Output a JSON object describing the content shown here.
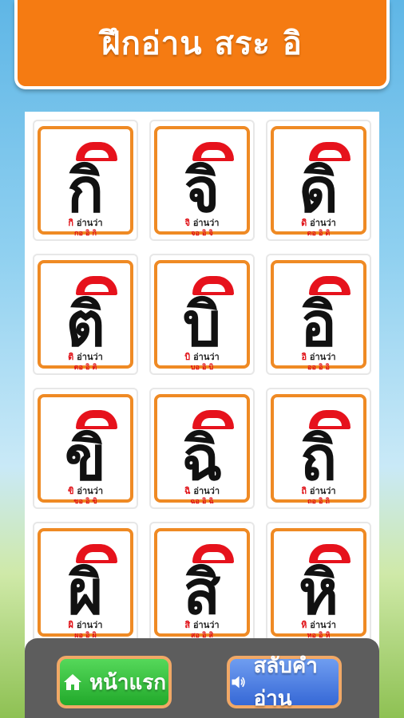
{
  "header": {
    "title": "ฝึกอ่าน สระ อิ"
  },
  "cards": [
    {
      "letter": "กิ",
      "small": "กิ",
      "reads_as": "อ่านว่า",
      "spell": "กอ อิ กิ"
    },
    {
      "letter": "จิ",
      "small": "จิ",
      "reads_as": "อ่านว่า",
      "spell": "จอ อิ จิ"
    },
    {
      "letter": "ดิ",
      "small": "ดิ",
      "reads_as": "อ่านว่า",
      "spell": "ดอ อิ ดิ"
    },
    {
      "letter": "ติ",
      "small": "ติ",
      "reads_as": "อ่านว่า",
      "spell": "ตอ อิ ติ"
    },
    {
      "letter": "บิ",
      "small": "บิ",
      "reads_as": "อ่านว่า",
      "spell": "บอ อิ บิ"
    },
    {
      "letter": "อิ",
      "small": "อิ",
      "reads_as": "อ่านว่า",
      "spell": "ออ อิ อิ"
    },
    {
      "letter": "ขิ",
      "small": "ขิ",
      "reads_as": "อ่านว่า",
      "spell": "ขอ อิ ขิ"
    },
    {
      "letter": "ฉิ",
      "small": "ฉิ",
      "reads_as": "อ่านว่า",
      "spell": "ฉอ อิ ฉิ"
    },
    {
      "letter": "ถิ",
      "small": "ถิ",
      "reads_as": "อ่านว่า",
      "spell": "ถอ อิ ถิ"
    },
    {
      "letter": "ผิ",
      "small": "ผิ",
      "reads_as": "อ่านว่า",
      "spell": "ผอ อิ ผิ"
    },
    {
      "letter": "สิ",
      "small": "สิ",
      "reads_as": "อ่านว่า",
      "spell": "สอ อิ สิ"
    },
    {
      "letter": "หิ",
      "small": "หิ",
      "reads_as": "อ่านว่า",
      "spell": "หอ อิ หิ"
    }
  ],
  "toolbar": {
    "home_label": "หน้าแรก",
    "home_icon": "home-icon",
    "switch_label": "สลับคำอ่าน",
    "switch_icon": "speaker-icon"
  },
  "colors": {
    "header_bg": "#f57b12",
    "card_border": "#ef8a24",
    "vowel_red": "#e6121c",
    "home_button": "#2fbf35",
    "switch_button": "#4a7fe2",
    "bottom_bar": "#5d5d5d"
  }
}
